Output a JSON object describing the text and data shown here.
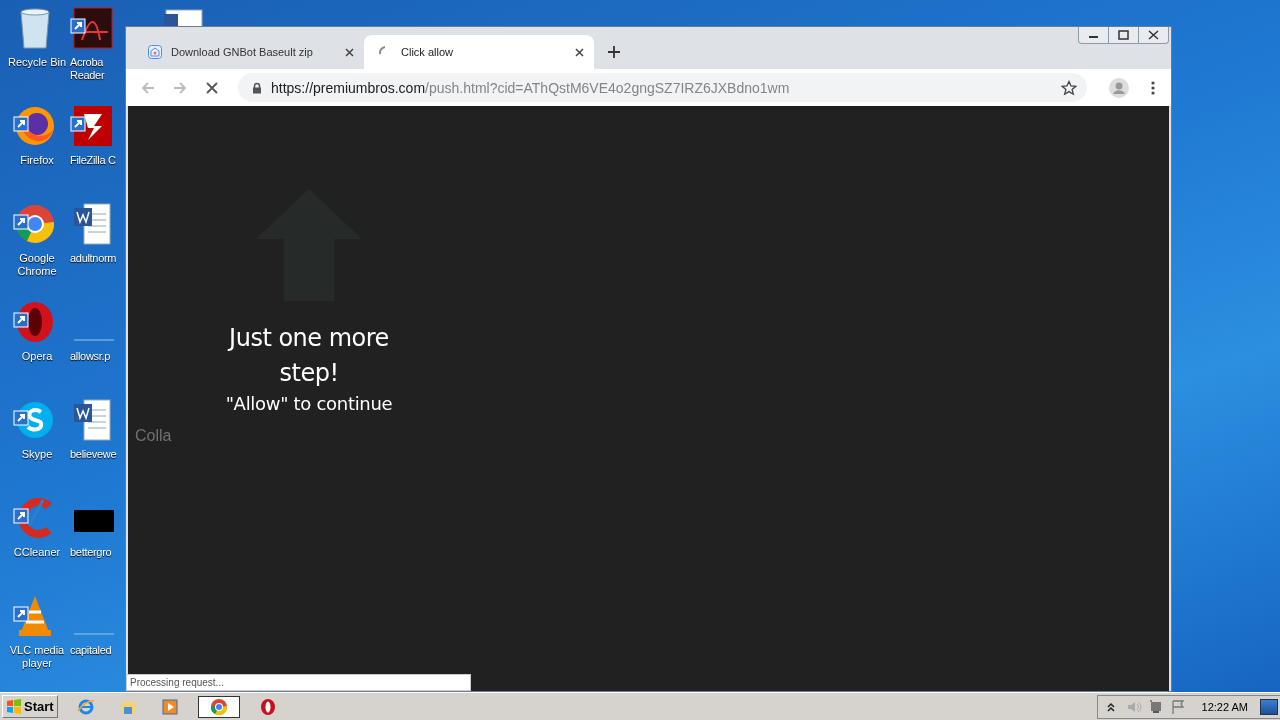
{
  "desktop_icons": [
    {
      "label": "Recycle Bin",
      "kind": "recycle"
    },
    {
      "label": "Acroba Reader",
      "kind": "acrobat"
    },
    {
      "label": "Firefox",
      "kind": "firefox"
    },
    {
      "label": "FileZilla C",
      "kind": "filezilla"
    },
    {
      "label": "Google Chrome",
      "kind": "chrome"
    },
    {
      "label": "adultnorm",
      "kind": "word"
    },
    {
      "label": "Opera",
      "kind": "opera"
    },
    {
      "label": "allowsr.p",
      "kind": "none"
    },
    {
      "label": "Skype",
      "kind": "skype"
    },
    {
      "label": "believewe",
      "kind": "word"
    },
    {
      "label": "CCleaner",
      "kind": "ccleaner"
    },
    {
      "label": "bettergro",
      "kind": "black"
    },
    {
      "label": "VLC media player",
      "kind": "vlc"
    },
    {
      "label": "capitaled",
      "kind": "none"
    }
  ],
  "browser": {
    "tabs": [
      {
        "title": "Download GNBot Baseult zip",
        "selected": false,
        "loading": false
      },
      {
        "title": "Click allow",
        "selected": true,
        "loading": true
      }
    ],
    "loading": true,
    "address": {
      "host": "https://premiumbros.com",
      "path": "/push.html?cid=AThQstM6VE4o2gngSZ7IRZ6JXBdno1wm"
    },
    "page": {
      "heading": "Just one more step!",
      "subtext": "\"Allow\" to continue",
      "hidden_text": "Colla"
    },
    "status": "Processing request..."
  },
  "taskbar": {
    "start": "Start",
    "apps": [
      {
        "kind": "ie",
        "selected": false
      },
      {
        "kind": "explorer",
        "selected": false
      },
      {
        "kind": "media",
        "selected": false
      },
      {
        "kind": "chrome",
        "selected": true
      },
      {
        "kind": "opera",
        "selected": false
      }
    ],
    "clock": "12:22 AM"
  }
}
